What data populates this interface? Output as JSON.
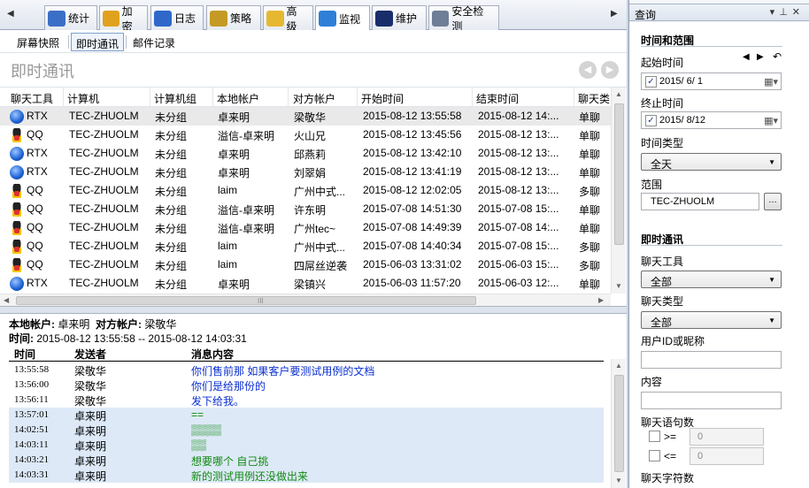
{
  "tabs": [
    {
      "label": "统计",
      "color": "#3b6fc6"
    },
    {
      "label": "加密",
      "color": "#e0a21d"
    },
    {
      "label": "日志",
      "color": "#2f68c9"
    },
    {
      "label": "策略",
      "color": "#c49a25"
    },
    {
      "label": "高级",
      "color": "#e6b830"
    },
    {
      "label": "监视",
      "color": "#2f7ed8"
    },
    {
      "label": "维护",
      "color": "#1a2d6b"
    },
    {
      "label": "安全检测",
      "color": "#6e7e96"
    }
  ],
  "subtabs": [
    "屏幕快照",
    "即时通讯",
    "邮件记录"
  ],
  "page_title": "即时通讯",
  "table": {
    "headers": [
      "聊天工具",
      "计算机",
      "计算机组",
      "本地帐户",
      "对方帐户",
      "开始时间",
      "结束时间",
      "聊天类"
    ],
    "rows": [
      {
        "tool": "RTX",
        "icon": "rtx-icon",
        "computer": "TEC-ZHUOLM",
        "group": "未分组",
        "local": "卓来明",
        "remote": "梁敬华",
        "start": "2015-08-12 13:55:58",
        "end": "2015-08-12 14:...",
        "type": "单聊"
      },
      {
        "tool": "QQ",
        "icon": "qq-icon",
        "computer": "TEC-ZHUOLM",
        "group": "未分组",
        "local": "溢信-卓来明",
        "remote": "火山兄",
        "start": "2015-08-12 13:45:56",
        "end": "2015-08-12 13:...",
        "type": "单聊"
      },
      {
        "tool": "RTX",
        "icon": "rtx-icon",
        "computer": "TEC-ZHUOLM",
        "group": "未分组",
        "local": "卓来明",
        "remote": "邱燕莉",
        "start": "2015-08-12 13:42:10",
        "end": "2015-08-12 13:...",
        "type": "单聊"
      },
      {
        "tool": "RTX",
        "icon": "rtx-icon",
        "computer": "TEC-ZHUOLM",
        "group": "未分组",
        "local": "卓来明",
        "remote": "刘翠娟",
        "start": "2015-08-12 13:41:19",
        "end": "2015-08-12 13:...",
        "type": "单聊"
      },
      {
        "tool": "QQ",
        "icon": "qq-icon",
        "computer": "TEC-ZHUOLM",
        "group": "未分组",
        "local": "laim",
        "remote": "广州中式...",
        "start": "2015-08-12 12:02:05",
        "end": "2015-08-12 13:...",
        "type": "多聊"
      },
      {
        "tool": "QQ",
        "icon": "qq-icon",
        "computer": "TEC-ZHUOLM",
        "group": "未分组",
        "local": "溢信-卓来明",
        "remote": "许东明",
        "start": "2015-07-08 14:51:30",
        "end": "2015-07-08 15:...",
        "type": "单聊"
      },
      {
        "tool": "QQ",
        "icon": "qq-icon",
        "computer": "TEC-ZHUOLM",
        "group": "未分组",
        "local": "溢信-卓来明",
        "remote": "广州tec~",
        "start": "2015-07-08 14:49:39",
        "end": "2015-07-08 14:...",
        "type": "单聊"
      },
      {
        "tool": "QQ",
        "icon": "qq-icon",
        "computer": "TEC-ZHUOLM",
        "group": "未分组",
        "local": "laim",
        "remote": "广州中式...",
        "start": "2015-07-08 14:40:34",
        "end": "2015-07-08 15:...",
        "type": "多聊"
      },
      {
        "tool": "QQ",
        "icon": "qq-icon",
        "computer": "TEC-ZHUOLM",
        "group": "未分组",
        "local": "laim",
        "remote": "四屌丝逆袭",
        "start": "2015-06-03 13:31:02",
        "end": "2015-06-03 15:...",
        "type": "多聊"
      },
      {
        "tool": "RTX",
        "icon": "rtx-icon",
        "computer": "TEC-ZHUOLM",
        "group": "未分组",
        "local": "卓来明",
        "remote": "梁镇兴",
        "start": "2015-06-03 11:57:20",
        "end": "2015-06-03 12:...",
        "type": "单聊"
      }
    ]
  },
  "detail": {
    "local_label": "本地帐户:",
    "local_value": "卓来明",
    "remote_label": "对方帐户:",
    "remote_value": "梁敬华",
    "time_label": "时间:",
    "time_value": "2015-08-12 13:55:58 -- 2015-08-12 14:03:31",
    "headers": [
      "时间",
      "发送者",
      "消息内容"
    ],
    "messages": [
      {
        "time": "13:55:58",
        "sender": "梁敬华",
        "content": "你们售前那  如果客户要测试用例的文档",
        "mine": false
      },
      {
        "time": "13:56:00",
        "sender": "梁敬华",
        "content": "你们是给那份的",
        "mine": false
      },
      {
        "time": "13:56:11",
        "sender": "梁敬华",
        "content": "发下给我。",
        "mine": false
      },
      {
        "time": "13:57:01",
        "sender": "卓来明",
        "content": "==",
        "mine": true
      },
      {
        "time": "14:02:51",
        "sender": "卓来明",
        "content": "▒▒▒▒",
        "mine": true
      },
      {
        "time": "14:03:11",
        "sender": "卓来明",
        "content": "▒▒",
        "mine": true
      },
      {
        "time": "14:03:21",
        "sender": "卓来明",
        "content": "想要哪个  自己挑",
        "mine": true
      },
      {
        "time": "14:03:31",
        "sender": "卓来明",
        "content": "新的测试用例还没做出来",
        "mine": true
      }
    ]
  },
  "panel": {
    "title": "查询",
    "section1": "时间和范围",
    "start_label": "起始时间",
    "start_value": "2015/ 6/ 1",
    "end_label": "终止时间",
    "end_value": "2015/ 8/12",
    "time_type_label": "时间类型",
    "time_type_value": "全天",
    "scope_label": "范围",
    "scope_value": "TEC-ZHUOLM",
    "section2": "即时通讯",
    "chat_tool_label": "聊天工具",
    "chat_tool_value": "全部",
    "chat_type_label": "聊天类型",
    "chat_type_value": "全部",
    "user_label": "用户ID或昵称",
    "content_label": "内容",
    "sentences_label": "聊天语句数",
    "ge_label": ">=",
    "le_label": "<=",
    "ge_value": "0",
    "le_value": "0",
    "chars_label": "聊天字符数"
  }
}
